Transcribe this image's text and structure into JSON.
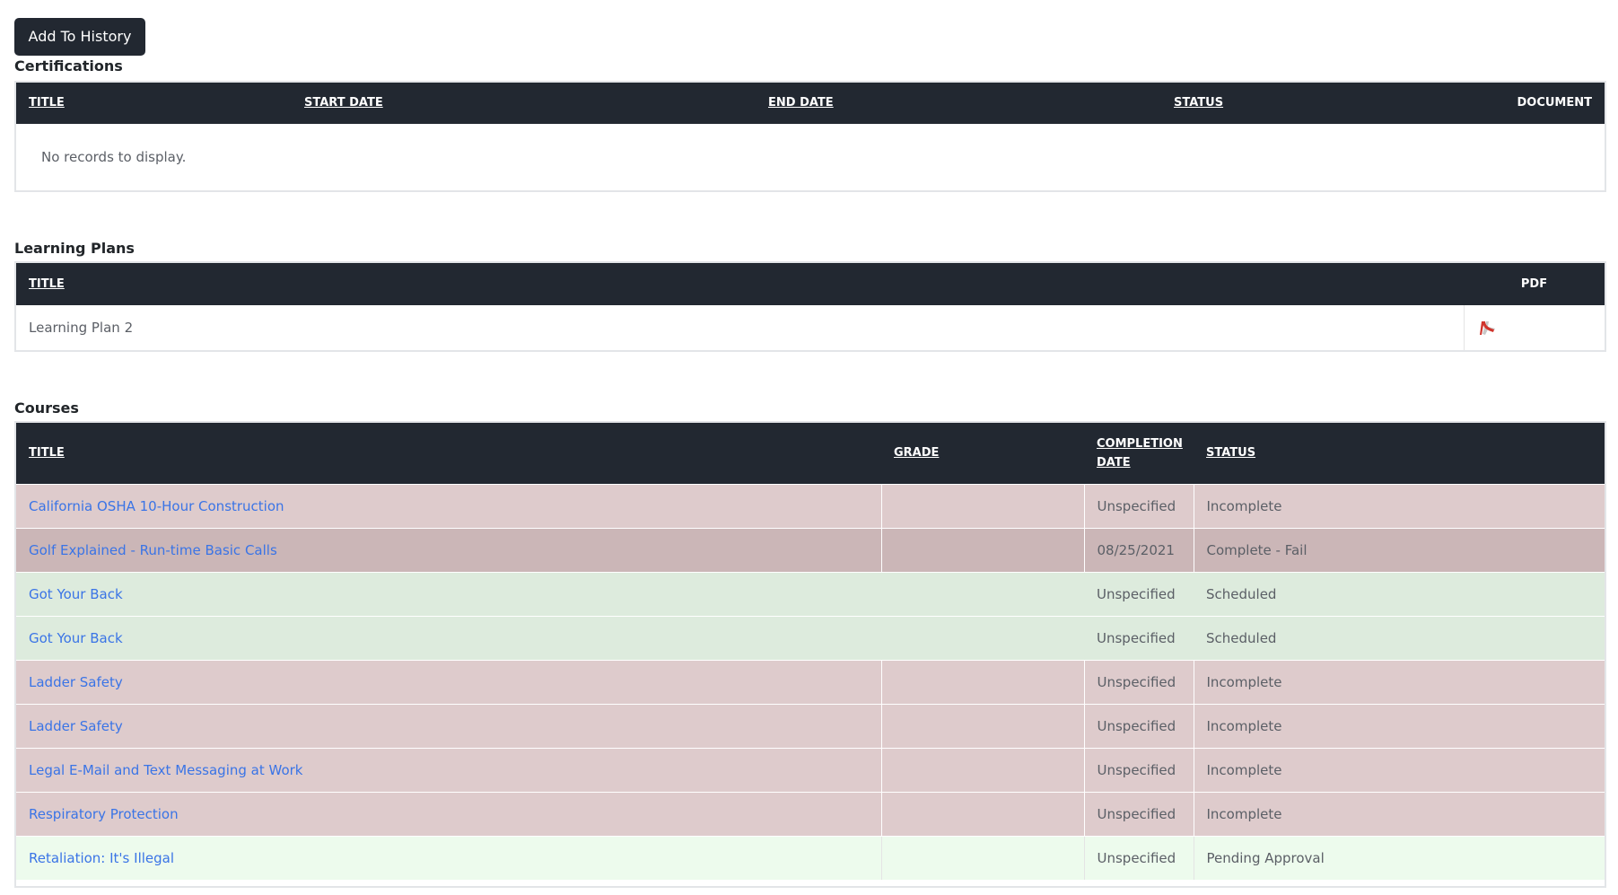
{
  "toolbar": {
    "add_history_label": "Add To History"
  },
  "certifications": {
    "title": "Certifications",
    "columns": [
      "TITLE",
      "START DATE",
      "END DATE",
      "STATUS",
      "DOCUMENT"
    ],
    "empty_text": "No records to display."
  },
  "learning_plans": {
    "title": "Learning Plans",
    "columns": [
      "TITLE",
      "PDF"
    ],
    "rows": [
      {
        "title": "Learning Plan 2",
        "pdf_icon": "pdf-icon"
      }
    ]
  },
  "courses": {
    "title": "Courses",
    "columns": {
      "title": "TITLE",
      "grade": "GRADE",
      "completion_line1": "COMPLETION",
      "completion_line2": "DATE",
      "status": "STATUS"
    },
    "rows": [
      {
        "title": "California OSHA 10-Hour Construction",
        "grade": "",
        "date": "Unspecified",
        "status": "Incomplete"
      },
      {
        "title": "Golf Explained - Run-time Basic Calls",
        "grade": "",
        "date": "08/25/2021",
        "status": "Complete - Fail"
      },
      {
        "title": "Got Your Back",
        "grade": "",
        "date": "Unspecified",
        "status": "Scheduled"
      },
      {
        "title": "Got Your Back",
        "grade": "",
        "date": "Unspecified",
        "status": "Scheduled"
      },
      {
        "title": "Ladder Safety",
        "grade": "",
        "date": "Unspecified",
        "status": "Incomplete"
      },
      {
        "title": "Ladder Safety",
        "grade": "",
        "date": "Unspecified",
        "status": "Incomplete"
      },
      {
        "title": "Legal E-Mail and Text Messaging at Work",
        "grade": "",
        "date": "Unspecified",
        "status": "Incomplete"
      },
      {
        "title": "Respiratory Protection",
        "grade": "",
        "date": "Unspecified",
        "status": "Incomplete"
      },
      {
        "title": "Retaliation: It's Illegal",
        "grade": "",
        "date": "Unspecified",
        "status": "Pending Approval"
      }
    ]
  },
  "colors": {
    "header_bg": "#222831",
    "incomplete_row": "#decbcc",
    "fail_row": "#cbb6b7",
    "scheduled_row": "#ddebdd",
    "pending_row": "#edfbed",
    "link": "#3a74e6"
  }
}
